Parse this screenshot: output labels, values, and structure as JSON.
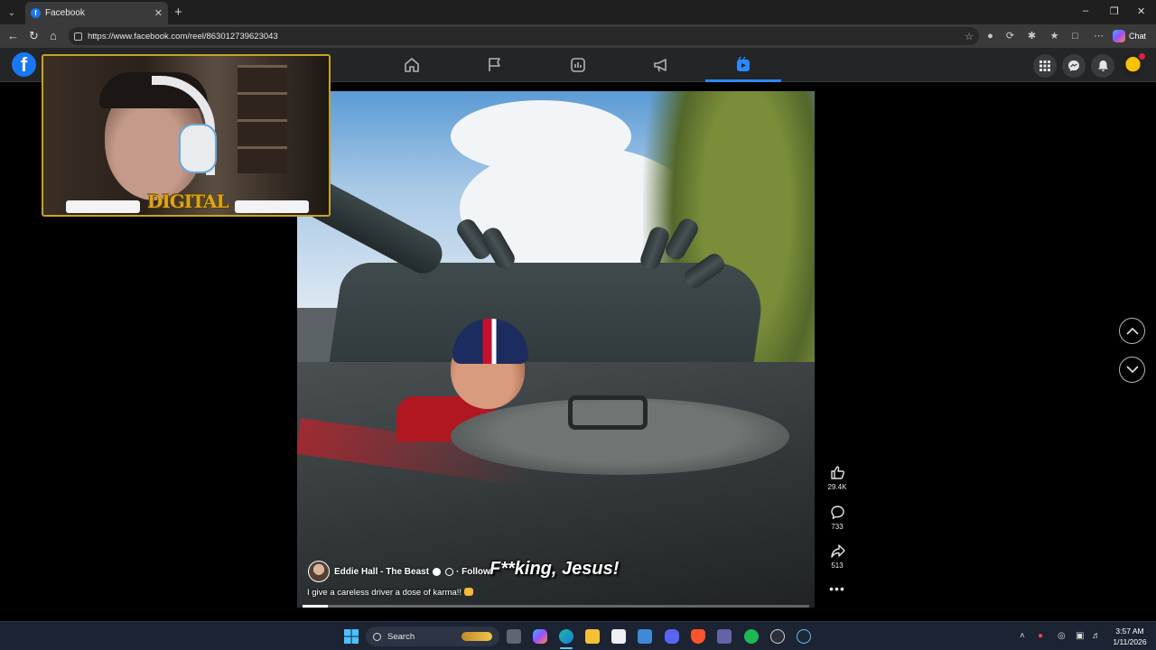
{
  "browser": {
    "tab_title": "Facebook",
    "favicon_letter": "f",
    "url": "https://www.facebook.com/reel/863012739623043",
    "copilot_label": "Chat"
  },
  "facebook": {
    "logo_letter": "f",
    "nav_icons": [
      "home-icon",
      "flag-icon",
      "marketplace-icon",
      "megaphone-icon",
      "reels-icon"
    ],
    "active_nav": "reels-icon"
  },
  "reel": {
    "author": "Eddie Hall - The Beast",
    "follow_label": "Follow",
    "subtitle": "F**king, Jesus!",
    "description": "I give a careless driver a dose of karma!!",
    "likes": "29.4K",
    "comments": "733",
    "shares": "513",
    "progress": 0.05
  },
  "overlay": {
    "logo_text": "DIGITAL"
  },
  "taskbar": {
    "search_placeholder": "Search",
    "time": "3:57 AM",
    "date": "1/11/2026"
  }
}
